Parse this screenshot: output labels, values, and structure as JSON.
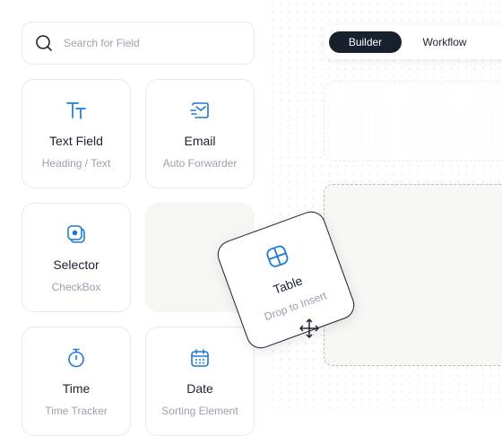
{
  "colors": {
    "accent": "#1f7ad6",
    "dark": "#18202d",
    "muted": "#9aa1ad"
  },
  "search": {
    "placeholder": "Search for Field",
    "icon": "search-icon"
  },
  "tabs": [
    {
      "label": "Builder",
      "active": true
    },
    {
      "label": "Workflow",
      "active": false
    }
  ],
  "fields": [
    {
      "title": "Text Field",
      "subtitle": "Heading / Text",
      "icon": "text-type-icon"
    },
    {
      "title": "Email",
      "subtitle": "Auto Forwarder",
      "icon": "email-icon"
    },
    {
      "title": "Selector",
      "subtitle": "CheckBox",
      "icon": "selector-icon"
    },
    {
      "title": "Time",
      "subtitle": "Time Tracker",
      "icon": "stopwatch-icon"
    },
    {
      "title": "Date",
      "subtitle": "Sorting Element",
      "icon": "calendar-icon"
    }
  ],
  "dragging": {
    "title": "Table",
    "subtitle": "Drop to Insert",
    "icon": "table-icon"
  }
}
